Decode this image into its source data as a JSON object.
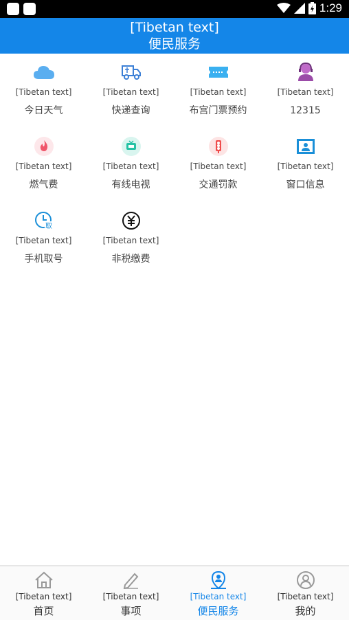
{
  "status_bar": {
    "time": "1:29"
  },
  "header": {
    "title_bo": "[Tibetan text]",
    "title_zh": "便民服务"
  },
  "services": [
    {
      "label_bo": "[Tibetan text]",
      "label_zh": "今日天气",
      "icon": "cloud-icon"
    },
    {
      "label_bo": "[Tibetan text]",
      "label_zh": "快递查询",
      "icon": "delivery-truck-icon"
    },
    {
      "label_bo": "[Tibetan text]",
      "label_zh": "布宫门票预约",
      "icon": "ticket-icon"
    },
    {
      "label_bo": "[Tibetan text]",
      "label_zh": "12315",
      "icon": "customer-service-icon"
    },
    {
      "label_bo": "[Tibetan text]",
      "label_zh": "燃气费",
      "icon": "flame-icon"
    },
    {
      "label_bo": "[Tibetan text]",
      "label_zh": "有线电视",
      "icon": "tv-icon"
    },
    {
      "label_bo": "[Tibetan text]",
      "label_zh": "交通罚款",
      "icon": "traffic-light-icon"
    },
    {
      "label_bo": "[Tibetan text]",
      "label_zh": "窗口信息",
      "icon": "window-info-icon"
    },
    {
      "label_bo": "[Tibetan text]",
      "label_zh": "手机取号",
      "icon": "queue-number-icon"
    },
    {
      "label_bo": "[Tibetan text]",
      "label_zh": "非税缴费",
      "icon": "yuan-icon"
    }
  ],
  "tabs": [
    {
      "label_bo": "[Tibetan text]",
      "label_zh": "首页",
      "icon": "home-icon",
      "active": false
    },
    {
      "label_bo": "[Tibetan text]",
      "label_zh": "事项",
      "icon": "pen-icon",
      "active": false
    },
    {
      "label_bo": "[Tibetan text]",
      "label_zh": "便民服务",
      "icon": "location-person-icon",
      "active": true
    },
    {
      "label_bo": "[Tibetan text]",
      "label_zh": "我的",
      "icon": "user-icon",
      "active": false
    }
  ],
  "colors": {
    "brand": "#1486e8",
    "weather": "#5aaef0",
    "delivery": "#3b7fd6",
    "ticket": "#3ab0f0",
    "service": "#9b4ba8",
    "gas_bg": "#fde7ea",
    "gas": "#f0566a",
    "tv_bg": "#d9f5ef",
    "tv": "#25c2a5",
    "traffic_bg": "#fde4e4",
    "traffic": "#ef4b4b",
    "window": "#1a8fd8",
    "inactive_tab": "#999999"
  }
}
